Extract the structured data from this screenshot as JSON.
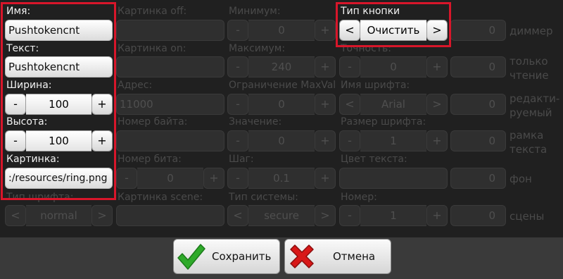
{
  "fields": {
    "name": {
      "label": "Имя:",
      "value": "Pushtokencnt"
    },
    "text": {
      "label": "Текст:",
      "value": "Pushtokencnt"
    },
    "width": {
      "label": "Ширина:",
      "minus": "-",
      "value": "100",
      "plus": "+"
    },
    "height": {
      "label": "Высота:",
      "minus": "-",
      "value": "100",
      "plus": "+"
    },
    "image": {
      "label": "Картинка:",
      "value": ":/resources/ring.png"
    },
    "font_type": {
      "label": "Тип шрифта:",
      "prev": "<",
      "value": "normal",
      "next": ">"
    },
    "image_off": {
      "label": "Картинка off:",
      "value": ""
    },
    "image_on": {
      "label": "Картинка on:",
      "value": ""
    },
    "address": {
      "label": "Адрес:",
      "value": "11000"
    },
    "byte_number": {
      "label": "Номер байта:",
      "value": ""
    },
    "bit_number": {
      "label": "Номер бита:",
      "minus": "-",
      "value": "0",
      "plus": "+"
    },
    "image_scene": {
      "label": "Картинка scene:",
      "value": ""
    },
    "minimum": {
      "label": "Минимум:",
      "minus": "-",
      "value": "0",
      "plus": "+"
    },
    "maximum": {
      "label": "Максимум:",
      "minus": "-",
      "value": "240",
      "plus": "+"
    },
    "limit_maxval": {
      "label": "Ограничение MaxVal",
      "minus": "-",
      "value": "0",
      "plus": "+"
    },
    "value": {
      "label": "Значение:",
      "minus": "-",
      "value": "0",
      "plus": "+"
    },
    "step": {
      "label": "Шаг:",
      "minus": "-",
      "value": "0.1",
      "plus": "+"
    },
    "system_type": {
      "label": "Тип системы:",
      "prev": "<",
      "value": "secure",
      "next": ">"
    },
    "button_type": {
      "label": "Тип кнопки",
      "prev": "<",
      "value": "Очистить",
      "next": ">"
    },
    "precision": {
      "label": "Точность:",
      "minus": "-",
      "value": "0",
      "plus": "+"
    },
    "font_name": {
      "label": "Имя шрифта:",
      "prev": "<",
      "value": "Arial",
      "next": ">"
    },
    "font_size": {
      "label": "Размер шрифта:",
      "minus": "-",
      "value": "1",
      "plus": "+"
    },
    "text_color": {
      "label": "Цвет текста:",
      "value": ""
    },
    "number": {
      "label": "Номер:",
      "minus": "-",
      "value": "1",
      "plus": "+"
    }
  },
  "options": {
    "dimmer": {
      "value": "0",
      "label": "диммер"
    },
    "readonly": {
      "value": "0",
      "label_line1": "только",
      "label_line2": "чтение"
    },
    "editable": {
      "value": "0",
      "label_line1": "редакти-",
      "label_line2": "руемый"
    },
    "text_frame": {
      "value": "0",
      "label_line1": "рамка",
      "label_line2": "текста"
    },
    "background": {
      "value": "0",
      "label": "фон"
    },
    "scenes": {
      "value": "0",
      "label": "сцены"
    }
  },
  "footer": {
    "save_label": "Сохранить",
    "cancel_label": "Отмена"
  },
  "colors": {
    "highlight_border": "#d8162a",
    "panel_bg": "#202020",
    "footer_bg": "#3a3a3a",
    "save_icon": "#2faa2a",
    "cancel_icon": "#d81818"
  }
}
